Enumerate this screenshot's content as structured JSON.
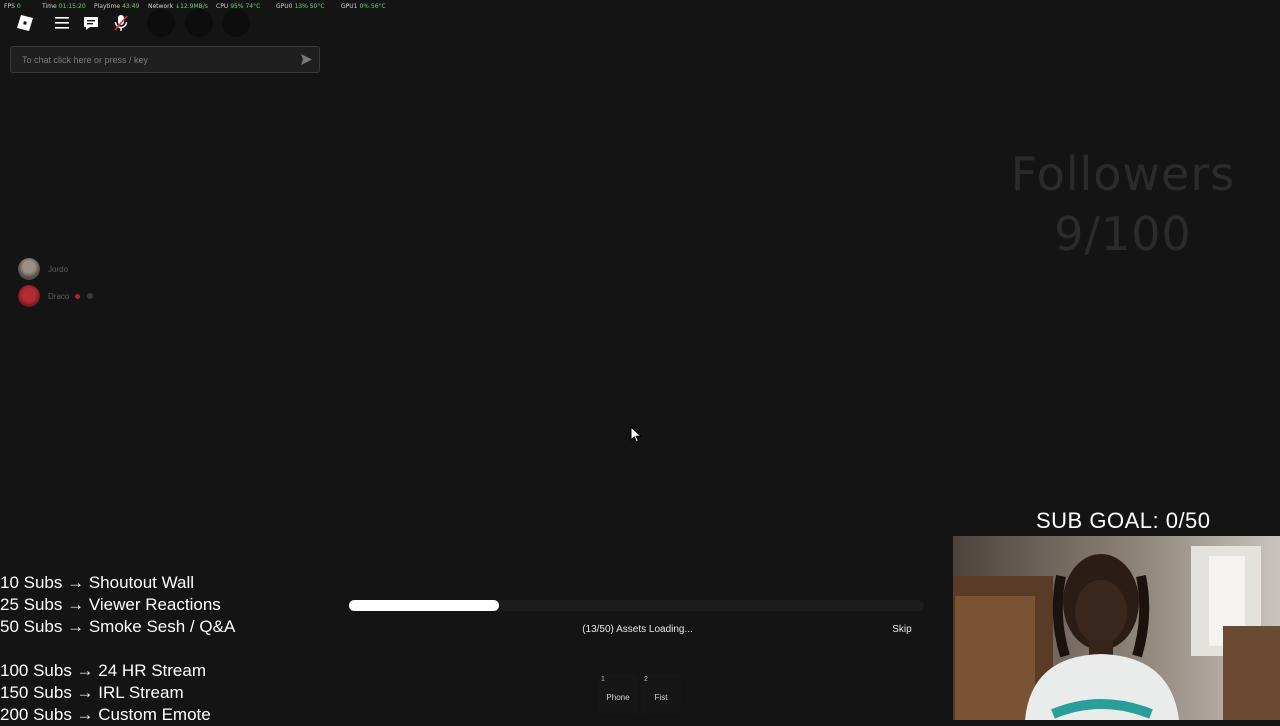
{
  "stats": {
    "fps_label": "FPS",
    "fps_value": "0",
    "time_label": "Time",
    "time_value": "01:15:20",
    "playtime_label": "Playtime",
    "playtime_value": "43:49",
    "network_label": "Network",
    "network_value": "↓12.9MB/s",
    "cpu_label": "CPU",
    "cpu_value": "95% 74°C",
    "gpu0_label": "GPU0",
    "gpu0_value": "13% 50°C",
    "gpu1_label": "GPU1",
    "gpu1_value": "0% 56°C"
  },
  "topbar": {
    "icons": [
      "roblox-logo-icon",
      "hamburger-menu-icon",
      "chat-icon",
      "microphone-icon"
    ]
  },
  "chat": {
    "placeholder": "To chat click here or press / key"
  },
  "players": [
    {
      "name": "Jordo"
    },
    {
      "name": "Draco"
    }
  ],
  "followers": {
    "label": "Followers",
    "count": "9/100"
  },
  "sub_goal": "SUB GOAL: 0/50",
  "subs": [
    "10 Subs → Shoutout Wall",
    "25 Subs → Viewer Reactions",
    "50 Subs → Smoke Sesh / Q&A",
    "100 Subs → 24 HR Stream",
    "150 Subs → IRL Stream",
    "200 Subs → Custom Emote"
  ],
  "loading": {
    "text": "(13/50) Assets Loading...",
    "skip_label": "Skip",
    "progress_fraction": 0.26
  },
  "hotbar": [
    {
      "slot": "1",
      "label": "Phone"
    },
    {
      "slot": "2",
      "label": "Fist"
    }
  ],
  "colors": {
    "background": "#141414",
    "stat_value_green": "#6bd36b",
    "followers_text": "#2b2b2b"
  }
}
